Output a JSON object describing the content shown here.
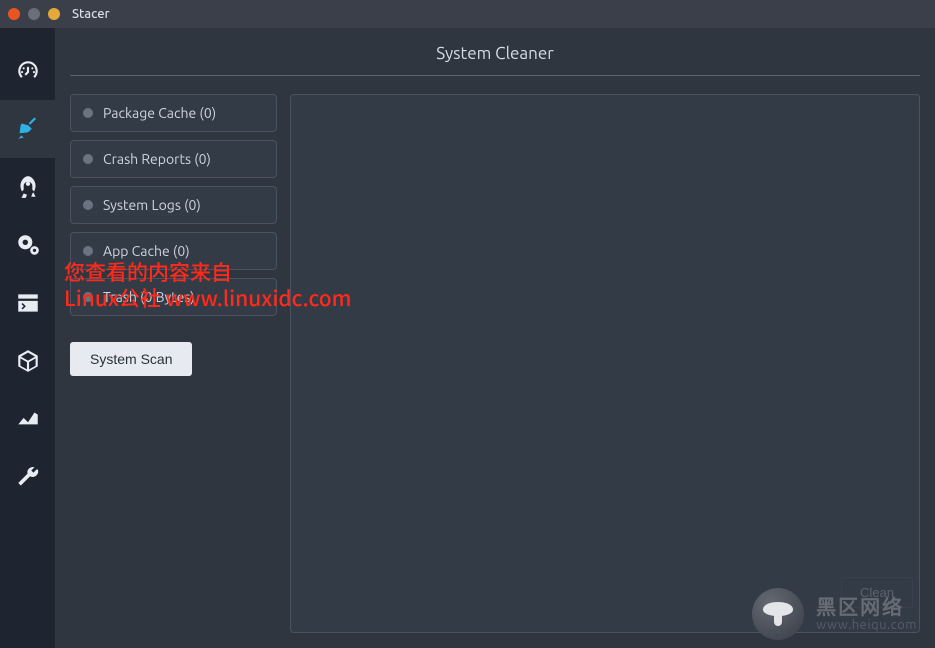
{
  "window": {
    "title": "Stacer"
  },
  "sidebar": {
    "items": [
      {
        "name": "dashboard"
      },
      {
        "name": "system-cleaner",
        "active": true
      },
      {
        "name": "startup-apps"
      },
      {
        "name": "services"
      },
      {
        "name": "processes"
      },
      {
        "name": "uninstaller"
      },
      {
        "name": "resources"
      },
      {
        "name": "settings"
      }
    ]
  },
  "page": {
    "title": "System Cleaner"
  },
  "categories": [
    {
      "label": "Package Cache (0)"
    },
    {
      "label": "Crash Reports (0)"
    },
    {
      "label": "System Logs (0)"
    },
    {
      "label": "App Cache (0)"
    },
    {
      "label": "Trash (0 Bytes)"
    }
  ],
  "buttons": {
    "scan": "System Scan",
    "clean": "Clean"
  },
  "watermark": {
    "line1": "您查看的内容来自",
    "line2": "Linux公社 www.linuxidc.com",
    "logo_cn": "黑区网络",
    "logo_en": "www.heiqu.com"
  }
}
